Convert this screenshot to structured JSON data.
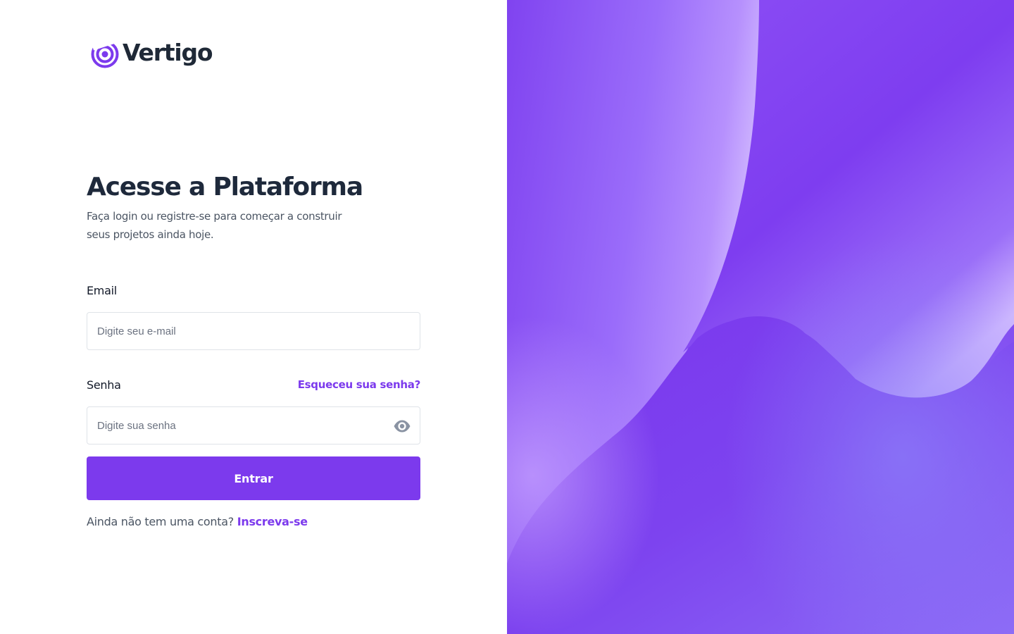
{
  "brand": {
    "name": "Vertigo",
    "accent_color": "#7c3aed"
  },
  "header": {
    "title": "Acesse a Plataforma",
    "subtitle": "Faça login ou registre-se para começar a construir seus projetos ainda hoje."
  },
  "form": {
    "email": {
      "label": "Email",
      "placeholder": "Digite seu e-mail",
      "value": ""
    },
    "password": {
      "label": "Senha",
      "placeholder": "Digite sua senha",
      "value": "",
      "forgot_link": "Esqueceu sua senha?",
      "toggle_icon": "eye-icon"
    },
    "submit_label": "Entrar"
  },
  "signup": {
    "prompt": "Ainda não tem uma conta?",
    "link": "Inscreva-se"
  },
  "hero": {
    "style": "abstract purple gradient waves",
    "colors": [
      "#7c3aed",
      "#8b5cf6",
      "#c4b5fd",
      "#6366f1"
    ]
  }
}
